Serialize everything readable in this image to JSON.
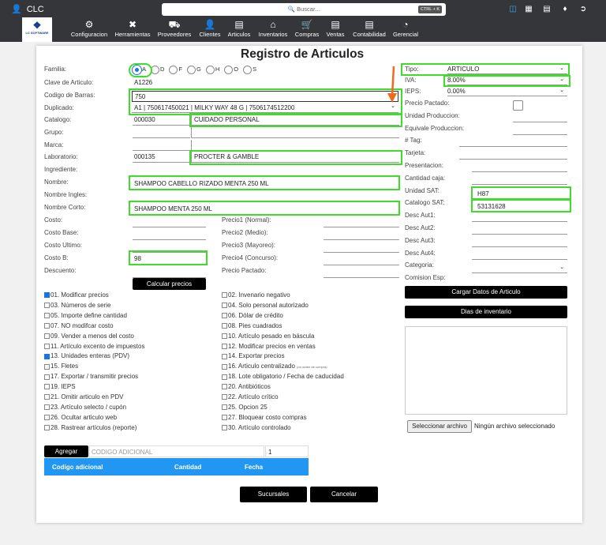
{
  "topbar": {
    "user": "CLC",
    "search_placeholder": "Buscar...",
    "shortcut": "CTRL + K",
    "icons": [
      "database-icon",
      "document-icon",
      "articles-icon",
      "tags-icon",
      "logout-icon"
    ]
  },
  "logo": {
    "text": "LC SOFTWARE"
  },
  "nav": [
    {
      "label": "Configuracion",
      "icon": "gear-icon"
    },
    {
      "label": "Herramientas",
      "icon": "tools-icon"
    },
    {
      "label": "Proveedores",
      "icon": "truck-icon"
    },
    {
      "label": "Clientes",
      "icon": "user-icon"
    },
    {
      "label": "Articulos",
      "icon": "box-icon"
    },
    {
      "label": "Inventarios",
      "icon": "warehouse-icon"
    },
    {
      "label": "Compras",
      "icon": "cart-icon"
    },
    {
      "label": "Ventas",
      "icon": "register-icon"
    },
    {
      "label": "Contabilidad",
      "icon": "invoice-icon"
    },
    {
      "label": "Gerencial",
      "icon": "pie-chart-icon"
    }
  ],
  "title": "Registro de Articulos",
  "form": {
    "familia_label": "Familia:",
    "familia_options": [
      "A",
      "D",
      "F",
      "G",
      "H",
      "O",
      "S"
    ],
    "familia_selected": "A",
    "clave_label": "Clave de Articulo:",
    "clave": "A1226",
    "codigo_label": "Codigo de Barras:",
    "codigo": "750",
    "duplicado_label": "Duplicado:",
    "duplicado": "A1 | 750617450021 | MILKY WAY 48 G | 7506174512200",
    "catalogo_label": "Catalogo:",
    "catalogo_code": "000030",
    "catalogo_name": "CUIDADO PERSONAL",
    "grupo_label": "Grupo:",
    "marca_label": "Marca:",
    "laboratorio_label": "Laboratorio:",
    "laboratorio_code": "000135",
    "laboratorio_name": "PROCTER & GAMBLE",
    "ingrediente_label": "Ingrediente:",
    "nombre_label": "Nombre:",
    "nombre": "SHAMPOO CABELLO RIZADO MENTA 250 ML",
    "nombre_ingles_label": "Nombre Ingles:",
    "nombre_corto_label": "Nombre Corto:",
    "nombre_corto": "SHAMPOO MENTA 250 ML",
    "costo_label": "Costo:",
    "costo_base_label": "Costo Base:",
    "costo_ultimo_label": "Costo Ultimo:",
    "costo_b_label": "Costo B:",
    "costo_b": "98",
    "descuento_label": "Descuento:",
    "precios": [
      "Precio1 (Normal):",
      "Precio2 (Medio):",
      "Precio3 (Mayoreo):",
      "Precio4 (Concurso):",
      "Precio Pactado:"
    ],
    "calcular": "Calcular precios"
  },
  "options_left": [
    {
      "t": "01. Modificar precios",
      "c": true
    },
    {
      "t": "03. Números de serie",
      "c": false
    },
    {
      "t": "05. Importe define cantidad",
      "c": false
    },
    {
      "t": "07. NO modifcar costo",
      "c": false
    },
    {
      "t": "09. Vender a menos del costo",
      "c": false
    },
    {
      "t": "11. Artículo excento de impuestos",
      "c": false
    },
    {
      "t": "13. Unidades enteras (PDV)",
      "c": true
    },
    {
      "t": "15. Fletes",
      "c": false
    },
    {
      "t": "17. Exportar / transmitir precios",
      "c": false
    },
    {
      "t": "19. IEPS",
      "c": false
    },
    {
      "t": "21. Omitir articulo en PDV",
      "c": false
    },
    {
      "t": "23. Artículo selecto / cupón",
      "c": false
    },
    {
      "t": "26. Ocultar articulo web",
      "c": false
    },
    {
      "t": "28. Rastrear artículos (reporte)",
      "c": false
    }
  ],
  "options_right": [
    {
      "t": "02. Invenario negativo",
      "c": false
    },
    {
      "t": "04. Solo personal autorizado",
      "c": false
    },
    {
      "t": "06. Dólar de crédito",
      "c": false
    },
    {
      "t": "08. Pies cuadrados",
      "c": false
    },
    {
      "t": "10. Artículo pesado en báscula",
      "c": false
    },
    {
      "t": "12. Modificar precios en ventas",
      "c": false
    },
    {
      "t": "14. Exportar precios",
      "c": false
    },
    {
      "t": "16. Articulo centralizado",
      "c": false,
      "note": "(no orden de compra)"
    },
    {
      "t": "18. Lote obligatorio / Fecha de caducidad",
      "c": false
    },
    {
      "t": "20. Antibióticos",
      "c": false
    },
    {
      "t": "22. Artículo crítico",
      "c": false
    },
    {
      "t": "25. Opcion 25",
      "c": false
    },
    {
      "t": "27. Bloquear costo compras",
      "c": false
    },
    {
      "t": "30. Artículo controlado",
      "c": false
    }
  ],
  "right": {
    "tipo_label": "Tipo:",
    "tipo": "ARTICULO",
    "iva_label": "IVA:",
    "iva": "8.00%",
    "ieps_label": "IEPS:",
    "ieps": "0.00%",
    "fields": [
      "Precio Pactado:",
      "Unidad Produccion:",
      "Equivale Produccion:",
      "# Tag:",
      "Tarjeta:",
      "Presentacion:",
      "Cantidad caja:",
      "Unidad SAT:",
      "Catalogo SAT:",
      "Desc Aut1:",
      "Desc Aut2:",
      "Desc Aut3:",
      "Desc Aut4:",
      "Categoria:",
      "Comision Esp:"
    ],
    "unidad_sat": "H87",
    "catalogo_sat": "53131628",
    "cargar": "Cargar Datos de Articulo",
    "dias": "Dias de inventario",
    "file_button": "Seleccionar archivo",
    "file_status": "Ningún archivo seleccionado"
  },
  "codes": {
    "agregar": "Agregar",
    "placeholder": "CODIGO ADICIONAL",
    "qty": "1",
    "headers": [
      "Codigo adicional",
      "Cantidad",
      "Fecha"
    ],
    "header_color": "#2196f3"
  },
  "footer": {
    "sucursales": "Sucursales",
    "cancelar": "Cancelar"
  },
  "colors": {
    "highlight": "#3fdc2c",
    "annotation_arrow": "#f06a1d",
    "bar": "#34363a"
  }
}
